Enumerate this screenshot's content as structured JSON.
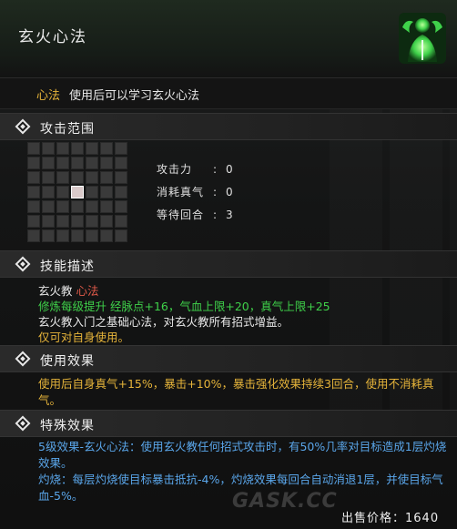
{
  "item": {
    "title": "玄火心法",
    "kind": "心法",
    "usage": "使用后可以学习玄火心法"
  },
  "sections": {
    "range_title": "攻击范围",
    "desc_title": "技能描述",
    "use_title": "使用效果",
    "special_title": "特殊效果"
  },
  "stats": [
    {
      "label": "攻击力",
      "colon": ":",
      "value": "0"
    },
    {
      "label": "消耗真气",
      "colon": ":",
      "value": "0"
    },
    {
      "label": "等待回合",
      "colon": ":",
      "value": "3"
    }
  ],
  "range_grid": {
    "rows": 7,
    "cols": 7,
    "active": [
      [
        3,
        3
      ]
    ]
  },
  "description": {
    "sect": "玄火教",
    "sect_kind": "心法",
    "cultivation": "修炼每级提升 经脉点+16，气血上限+20，真气上限+25",
    "line3": "玄火教入门之基础心法，对玄火教所有招式增益。",
    "line4": "仅可对自身使用。"
  },
  "use_effect": "使用后自身真气+15%，暴击+10%，暴击强化效果持续3回合，使用不消耗真气。",
  "special_effect": {
    "line1": "5级效果-玄火心法：使用玄火教任何招式攻击时，有50%几率对目标造成1层灼烧效果。",
    "line2": "灼烧：每层灼烧使目标暴击抵抗-4%，灼烧效果每回合自动消退1层，并使目标气血-5%。"
  },
  "sale": {
    "label": "出售价格：",
    "value": "1640"
  },
  "watermark": "GASK.CC",
  "colors": {
    "accent_green": "#3fd14a",
    "accent_yellow": "#e6b43a",
    "accent_blue": "#5aa6ea"
  }
}
